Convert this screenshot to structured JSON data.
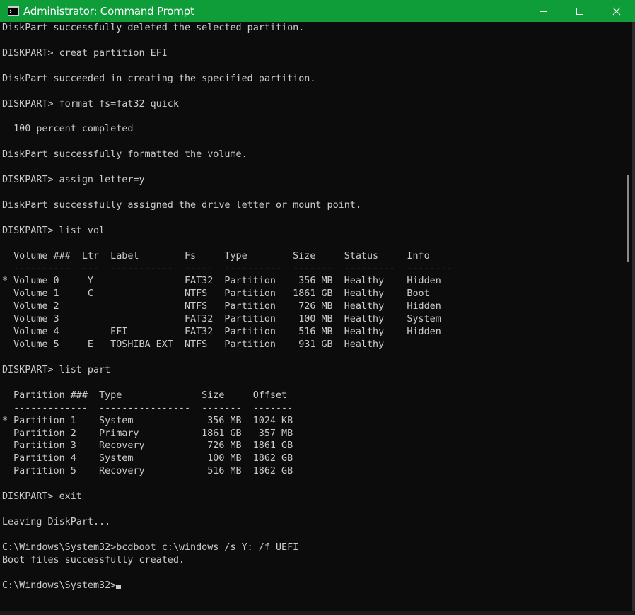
{
  "window": {
    "title": "Administrator: Command Prompt",
    "titlebar_color": "#0f9d3a",
    "background_color": "#0c0c0c",
    "text_color": "#cccccc"
  },
  "icons": {
    "app": "cmd-icon",
    "minimize": "minimize-icon",
    "maximize": "maximize-icon",
    "close": "close-icon"
  },
  "terminal": {
    "lines": [
      "DiskPart successfully deleted the selected partition.",
      "",
      "DISKPART> creat partition EFI",
      "",
      "DiskPart succeeded in creating the specified partition.",
      "",
      "DISKPART> format fs=fat32 quick",
      "",
      "  100 percent completed",
      "",
      "DiskPart successfully formatted the volume.",
      "",
      "DISKPART> assign letter=y",
      "",
      "DiskPart successfully assigned the drive letter or mount point.",
      "",
      "DISKPART> list vol",
      "",
      "  Volume ###  Ltr  Label        Fs     Type        Size     Status     Info",
      "  ----------  ---  -----------  -----  ----------  -------  ---------  --------",
      "* Volume 0     Y                FAT32  Partition    356 MB  Healthy    Hidden",
      "  Volume 1     C                NTFS   Partition   1861 GB  Healthy    Boot",
      "  Volume 2                      NTFS   Partition    726 MB  Healthy    Hidden",
      "  Volume 3                      FAT32  Partition    100 MB  Healthy    System",
      "  Volume 4         EFI          FAT32  Partition    516 MB  Healthy    Hidden",
      "  Volume 5     E   TOSHIBA EXT  NTFS   Partition    931 GB  Healthy",
      "",
      "DISKPART> list part",
      "",
      "  Partition ###  Type              Size     Offset",
      "  -------------  ----------------  -------  -------",
      "* Partition 1    System             356 MB  1024 KB",
      "  Partition 2    Primary           1861 GB   357 MB",
      "  Partition 3    Recovery           726 MB  1861 GB",
      "  Partition 4    System             100 MB  1862 GB",
      "  Partition 5    Recovery           516 MB  1862 GB",
      "",
      "DISKPART> exit",
      "",
      "Leaving DiskPart...",
      "",
      "C:\\Windows\\System32>bcdboot c:\\windows /s Y: /f UEFI",
      "Boot files successfully created.",
      "",
      "C:\\Windows\\System32>"
    ]
  }
}
